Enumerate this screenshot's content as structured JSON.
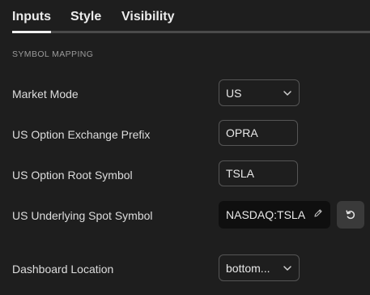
{
  "tabs": [
    {
      "label": "Inputs",
      "active": true
    },
    {
      "label": "Style",
      "active": false
    },
    {
      "label": "Visibility",
      "active": false
    }
  ],
  "section": {
    "title": "SYMBOL MAPPING"
  },
  "fields": {
    "market_mode": {
      "label": "Market Mode",
      "value": "US"
    },
    "exchange_prefix": {
      "label": "US Option Exchange Prefix",
      "value": "OPRA"
    },
    "root_symbol": {
      "label": "US Option Root Symbol",
      "value": "TSLA"
    },
    "spot_symbol": {
      "label": "US Underlying Spot Symbol",
      "value": "NASDAQ:TSLA"
    },
    "dashboard_location": {
      "label": "Dashboard Location",
      "value": "bottom..."
    }
  },
  "icons": {
    "chevron": "chevron-down-icon",
    "edit": "pencil-icon",
    "reset": "reset-icon"
  },
  "colors": {
    "background": "#1e1e1e",
    "border": "#555555",
    "tab_underline": "#efefef",
    "symbol_field_bg": "#0f0f0f",
    "reset_button_bg": "#3a3a3a"
  }
}
